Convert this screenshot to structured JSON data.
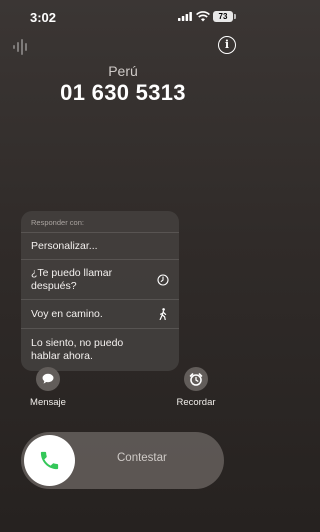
{
  "status_bar": {
    "time": "3:02",
    "battery": "73"
  },
  "call": {
    "country": "Perú",
    "number": "01 630 5313"
  },
  "reply_menu": {
    "header": "Responder con:",
    "items": [
      {
        "label": "Personalizar...",
        "icon": ""
      },
      {
        "label": "¿Te puedo llamar después?",
        "icon": "clock-icon"
      },
      {
        "label": "Voy en camino.",
        "icon": "walking-icon"
      },
      {
        "label": "Lo siento, no puedo hablar ahora.",
        "icon": ""
      }
    ]
  },
  "actions": {
    "message": {
      "label": "Mensaje",
      "icon": "message-bubble-icon"
    },
    "remind": {
      "label": "Recordar",
      "icon": "alarm-clock-icon"
    }
  },
  "answer_slider": {
    "label": "Contestar",
    "icon": "phone-icon",
    "color": "#34c759"
  },
  "colors": {
    "accent_green": "#34c759"
  }
}
